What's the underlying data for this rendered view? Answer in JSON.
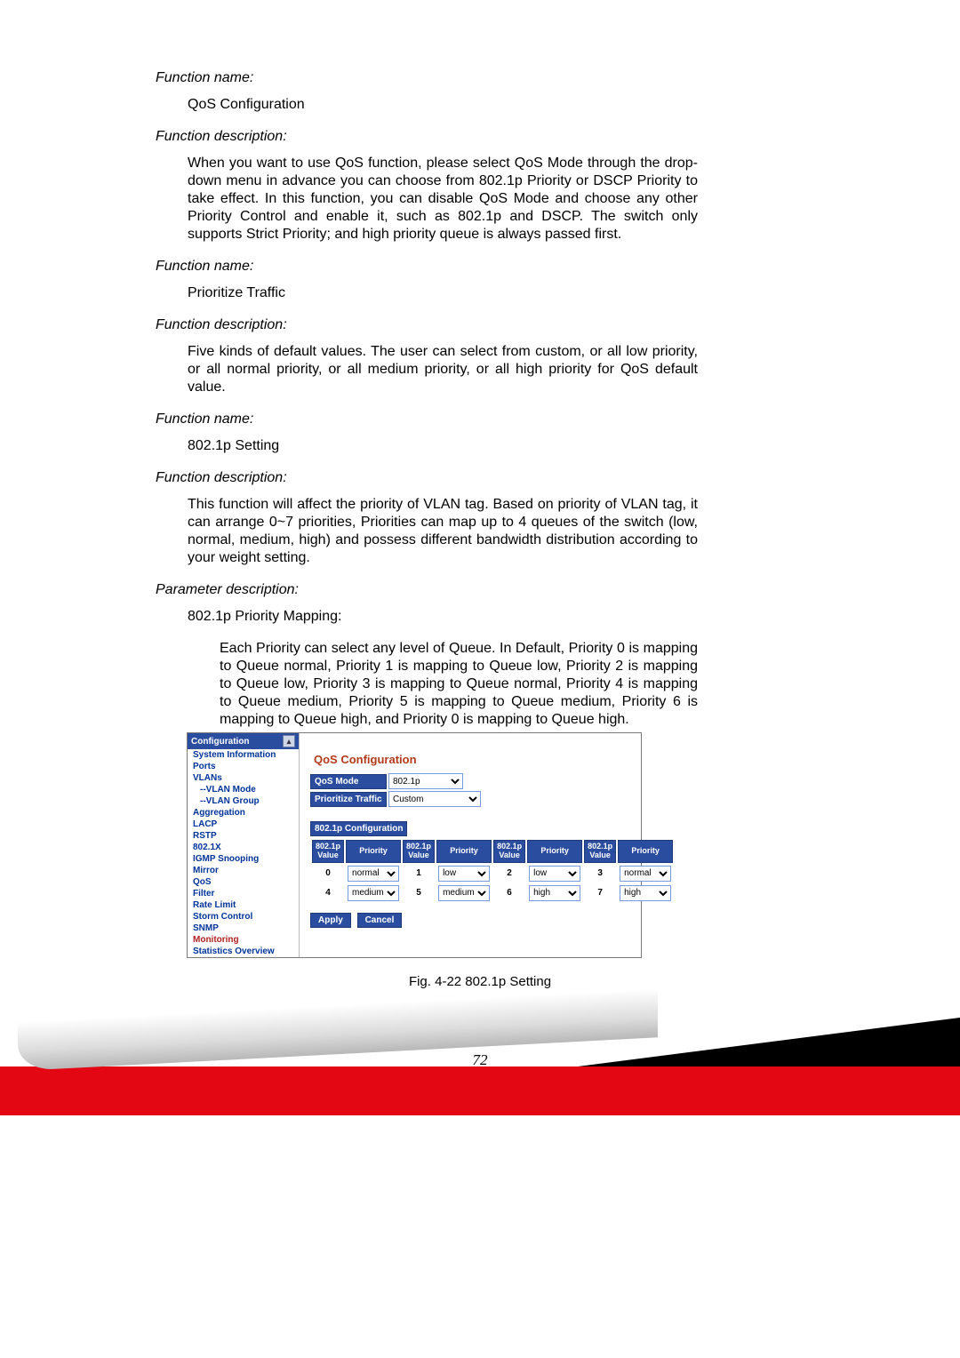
{
  "doc": {
    "fn1_label": "Function name:",
    "fn1_value": "QoS Configuration",
    "fd1_label": "Function description:",
    "fd1_para": "When you want to use QoS function, please select QoS Mode through the drop-down menu in advance you can choose from 802.1p Priority or DSCP Priority to take effect. In this function, you can disable QoS Mode and choose any other Priority Control and enable it, such as 802.1p and DSCP. The switch only supports Strict Priority; and high priority queue is always passed first.",
    "fn2_label": "Function name:",
    "fn2_value": "Prioritize Traffic",
    "fd2_label": "Function description:",
    "fd2_para": "Five kinds of default values. The user can select from custom, or all low priority, or all normal priority, or all medium priority, or all high priority for QoS default value.",
    "fn3_label": "Function name:",
    "fn3_value": "802.1p Setting",
    "fd3_label": "Function description:",
    "fd3_para": "This function will affect the priority of VLAN tag. Based on priority of VLAN tag, it can arrange 0~7 priorities, Priorities can map up to 4 queues of the switch (low, normal, medium, high) and possess different bandwidth distribution according to your weight setting.",
    "pd_label": "Parameter description:",
    "pm_title": "802.1p Priority Mapping:",
    "pm_para": "Each Priority can select any level of Queue. In Default, Priority 0 is mapping to Queue normal, Priority 1 is mapping to Queue low, Priority 2 is mapping to Queue low, Priority 3 is mapping to Queue normal, Priority 4 is mapping to Queue medium, Priority 5 is mapping to Queue medium, Priority 6 is mapping to Queue high, and Priority 0 is mapping to Queue high."
  },
  "sidebar": {
    "head": "Configuration",
    "items": [
      "System Information",
      "Ports",
      "VLANs",
      "--VLAN Mode",
      "--VLAN Group",
      "Aggregation",
      "LACP",
      "RSTP",
      "802.1X",
      "IGMP Snooping",
      "Mirror",
      "QoS",
      "Filter",
      "Rate Limit",
      "Storm Control",
      "SNMP",
      "Monitoring",
      "Statistics Overview"
    ]
  },
  "panel": {
    "title": "QoS Configuration",
    "mode_label": "QoS Mode",
    "mode_value": "802.1p",
    "pt_label": "Prioritize Traffic",
    "pt_value": "Custom",
    "section": "802.1p Configuration",
    "col_value": "802.1p Value",
    "col_prio": "Priority",
    "apply": "Apply",
    "cancel": "Cancel"
  },
  "chart_data": {
    "type": "table",
    "title": "802.1p Configuration",
    "columns": [
      "802.1p Value",
      "Priority"
    ],
    "rows": [
      {
        "value": 0,
        "priority": "normal"
      },
      {
        "value": 1,
        "priority": "low"
      },
      {
        "value": 2,
        "priority": "low"
      },
      {
        "value": 3,
        "priority": "normal"
      },
      {
        "value": 4,
        "priority": "medium"
      },
      {
        "value": 5,
        "priority": "medium"
      },
      {
        "value": 6,
        "priority": "high"
      },
      {
        "value": 7,
        "priority": "high"
      }
    ]
  },
  "caption": "Fig. 4-22 802.1p Setting",
  "page_number": "72"
}
